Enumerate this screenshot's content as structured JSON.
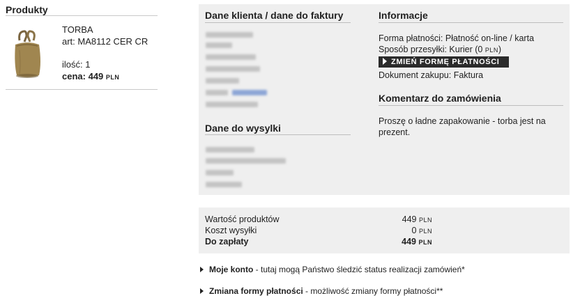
{
  "products": {
    "title": "Produkty",
    "item": {
      "name": "TORBA",
      "art": "art: MA8112 CER CR",
      "qty": "ilość: 1",
      "price_label": "cena:",
      "price_value": "449",
      "currency": "PLN"
    }
  },
  "client": {
    "title": "Dane klienta / dane do faktury"
  },
  "shipping": {
    "title": "Dane do wysylki"
  },
  "info": {
    "title": "Informacje",
    "payment": "Forma płatności: Płatność on-line / karta",
    "delivery_prefix": "Sposób przesyłki: Kurier (0",
    "delivery_currency": "PLN",
    "delivery_suffix": ")",
    "change_button": "ZMIEŃ FORMĘ PŁATNOŚCI",
    "document": "Dokument zakupu: Faktura"
  },
  "comment": {
    "title": "Komentarz do zamówienia",
    "text_line1": "Proszę o ładne zapakowanie - torba jest na",
    "text_line2": "prezent."
  },
  "totals": {
    "rows": [
      {
        "label": "Wartość produktów",
        "value": "449",
        "currency": "PLN"
      },
      {
        "label": "Koszt wysyłki",
        "value": "0",
        "currency": "PLN"
      },
      {
        "label": "Do zapłaty",
        "value": "449",
        "currency": "PLN"
      }
    ]
  },
  "links": [
    {
      "bold": "Moje konto",
      "rest": " - tutaj mogą Państwo śledzić status realizacji zamówień*"
    },
    {
      "bold": "Zmiana formy płatności",
      "rest": " - możliwość zmiany formy płatności**"
    }
  ]
}
